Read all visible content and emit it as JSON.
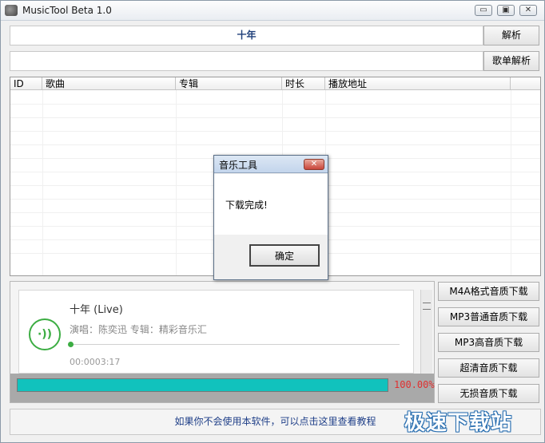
{
  "window": {
    "title": "MusicTool Beta 1.0",
    "controls": {
      "minimize": "▭",
      "maximize": "▣",
      "close": "✕"
    }
  },
  "search": {
    "query": "十年",
    "parse_label": "解析",
    "playlist_url": "",
    "playlist_parse_label": "歌单解析"
  },
  "table": {
    "columns": [
      "ID",
      "歌曲",
      "专辑",
      "时长",
      "播放地址",
      ""
    ],
    "rows": []
  },
  "player": {
    "song_title": "十年 (Live)",
    "meta": "演唱：陈奕迅 专辑：精彩音乐汇",
    "time": "00:0003:17",
    "play_icon_glyph": "·))",
    "scroll_grip_glyph": "≡"
  },
  "progress": {
    "percent": 100,
    "label": "100.00%",
    "fill_color": "#11c2bd"
  },
  "download_buttons": [
    "M4A格式音质下载",
    "MP3普通音质下载",
    "MP3高音质下载",
    "超清音质下载",
    "无损音质下载"
  ],
  "footer": {
    "help_link": "如果你不会使用本软件，可以点击这里查看教程",
    "watermark": "极速下载站"
  },
  "dialog": {
    "title": "音乐工具",
    "message": "下载完成!",
    "ok_label": "确定",
    "close_glyph": "✕"
  }
}
